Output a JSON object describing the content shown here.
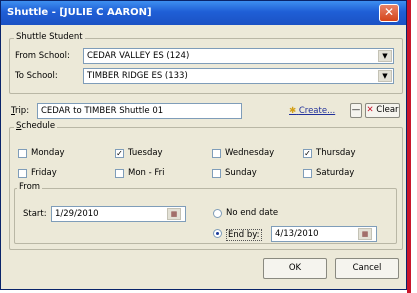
{
  "window": {
    "title": "Shuttle - [JULIE C AARON]"
  },
  "shuttle_student": {
    "legend": "Shuttle Student",
    "from_label": "From School:",
    "from_value": "CEDAR VALLEY ES (124)",
    "to_label": "To School:",
    "to_value": "TIMBER RIDGE ES (133)"
  },
  "trip": {
    "label": "Trip:",
    "value": "CEDAR to TIMBER Shuttle 01",
    "create_label": "Create...",
    "dash_label": "—",
    "clear_label": "Clear"
  },
  "schedule": {
    "legend": "Schedule",
    "days": [
      {
        "label": "Monday",
        "checked": false
      },
      {
        "label": "Tuesday",
        "checked": true
      },
      {
        "label": "Wednesday",
        "checked": false
      },
      {
        "label": "Thursday",
        "checked": true
      },
      {
        "label": "Friday",
        "checked": false
      },
      {
        "label": "Mon - Fri",
        "checked": false
      },
      {
        "label": "Sunday",
        "checked": false
      },
      {
        "label": "Saturday",
        "checked": false
      }
    ]
  },
  "from": {
    "legend": "From",
    "start_label": "Start:",
    "start_value": "1/29/2010",
    "no_end_label": "No end date",
    "end_by_label": "End by:",
    "end_by_value": "4/13/2010",
    "end_by_selected": true
  },
  "buttons": {
    "ok": "OK",
    "cancel": "Cancel"
  },
  "colors": {
    "title_bar": "#1f5fd6",
    "close_button": "#d5441a",
    "link": "#20309a",
    "dialog_bg": "#ece9d8"
  }
}
